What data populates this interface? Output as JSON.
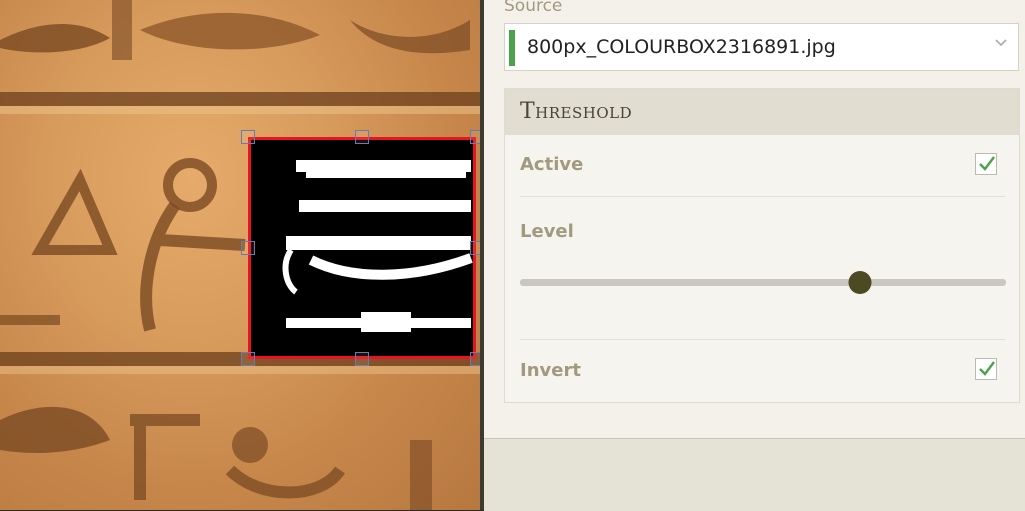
{
  "source": {
    "label": "Source",
    "selected_file": "800px_COLOURBOX2316891.jpg"
  },
  "threshold_panel": {
    "title": "Threshold",
    "active": {
      "label": "Active",
      "checked": true
    },
    "level": {
      "label": "Level",
      "value_fraction": 0.7
    },
    "invert": {
      "label": "Invert",
      "checked": true
    }
  },
  "colors": {
    "selection_border": "#e8141f",
    "accent_green": "#4aa34b",
    "slider_knob": "#4c4a22",
    "label_muted": "#a29a7e"
  }
}
